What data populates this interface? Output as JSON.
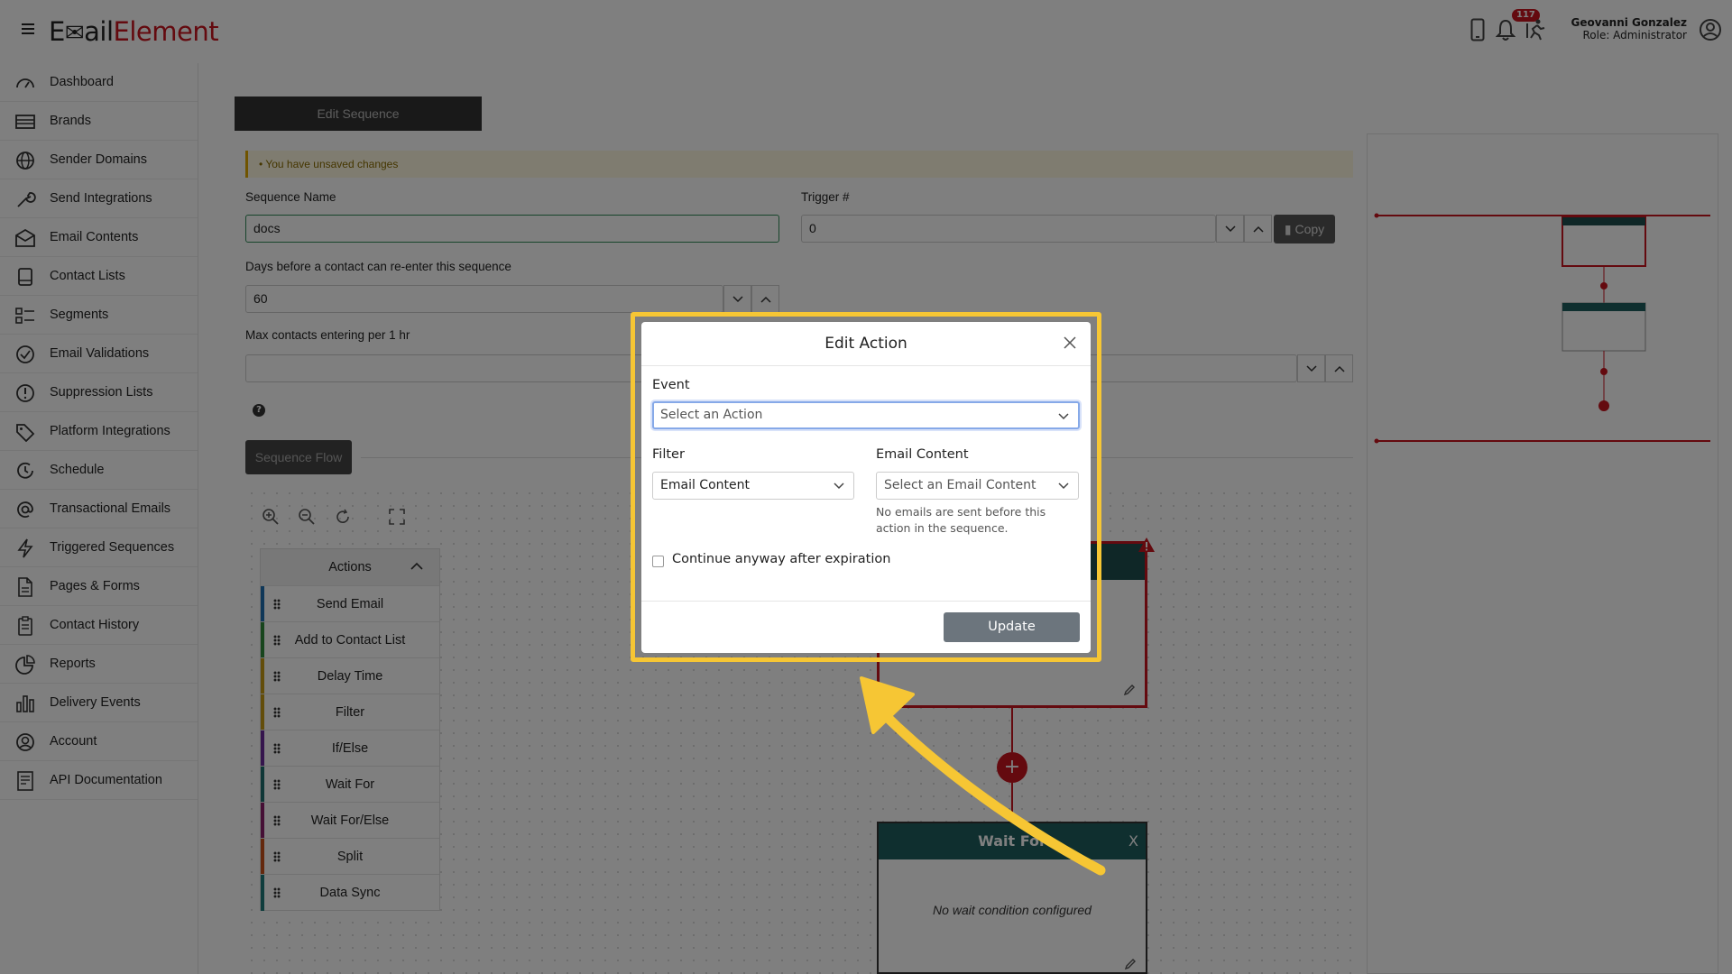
{
  "app": {
    "logo_part1": "E",
    "logo_part2": "ail",
    "logo_part3": "Element",
    "notification_count": "117",
    "user_name": "Geovanni Gonzalez",
    "user_role": "Role: Administrator"
  },
  "sidebar": {
    "items": [
      {
        "label": "Dashboard",
        "icon": "dashboard-icon"
      },
      {
        "label": "Brands",
        "icon": "brands-icon"
      },
      {
        "label": "Sender Domains",
        "icon": "globe-icon"
      },
      {
        "label": "Send Integrations",
        "icon": "wrench-icon"
      },
      {
        "label": "Email Contents",
        "icon": "envelope-icon"
      },
      {
        "label": "Contact Lists",
        "icon": "list-icon"
      },
      {
        "label": "Segments",
        "icon": "segments-icon"
      },
      {
        "label": "Email Validations",
        "icon": "check-circle-icon"
      },
      {
        "label": "Suppression Lists",
        "icon": "exclamation-circle-icon"
      },
      {
        "label": "Platform Integrations",
        "icon": "tag-icon"
      },
      {
        "label": "Schedule",
        "icon": "clock-icon"
      },
      {
        "label": "Transactional Emails",
        "icon": "at-icon"
      },
      {
        "label": "Triggered Sequences",
        "icon": "lightning-icon"
      },
      {
        "label": "Pages & Forms",
        "icon": "file-icon"
      },
      {
        "label": "Contact History",
        "icon": "clipboard-icon"
      },
      {
        "label": "Reports",
        "icon": "pie-chart-icon"
      },
      {
        "label": "Delivery Events",
        "icon": "bar-chart-icon"
      },
      {
        "label": "Account",
        "icon": "user-icon"
      },
      {
        "label": "API Documentation",
        "icon": "doc-icon"
      }
    ]
  },
  "editor": {
    "tab_label": "Edit Sequence",
    "unsaved_notice": "You have unsaved changes",
    "sequence_name_label": "Sequence Name",
    "sequence_name_value": "docs",
    "trigger_label": "Trigger #",
    "trigger_value": "0",
    "copy_label": "Copy",
    "reenter_label": "Days before a contact can re-enter this sequence",
    "reenter_value": "60",
    "max_contacts_label": "Max contacts entering per 1 hr",
    "help_glyph": "?",
    "flow_button": "Sequence Flow"
  },
  "actions_panel": {
    "title": "Actions",
    "items": [
      {
        "label": "Send Email",
        "color": "#1e6fb0"
      },
      {
        "label": "Add to Contact List",
        "color": "#2e8b3a"
      },
      {
        "label": "Delay Time",
        "color": "#c79a15"
      },
      {
        "label": "Filter",
        "color": "#c79a15"
      },
      {
        "label": "If/Else",
        "color": "#6a2a9a"
      },
      {
        "label": "Wait For",
        "color": "#1f6f6f"
      },
      {
        "label": "Wait For/Else",
        "color": "#8a1f6a"
      },
      {
        "label": "Split",
        "color": "#c9501a"
      },
      {
        "label": "Data Sync",
        "color": "#1f7a7a"
      }
    ]
  },
  "flow": {
    "plus_glyph": "+",
    "wait_for_title": "Wait For",
    "wait_for_close": "X",
    "wait_for_body": "No wait condition configured"
  },
  "modal": {
    "title": "Edit Action",
    "event_label": "Event",
    "event_placeholder": "Select an Action",
    "filter_label": "Filter",
    "filter_value": "Email Content",
    "email_content_label": "Email Content",
    "email_content_placeholder": "Select an Email Content",
    "hint_line1": "No emails are sent before this",
    "hint_line2": "action in the sequence.",
    "continue_label": "Continue anyway after expiration",
    "update_label": "Update"
  },
  "colors": {
    "brand_red": "#c8141e",
    "highlight_yellow": "#f6c634",
    "node_header": "#1f4f4f"
  }
}
